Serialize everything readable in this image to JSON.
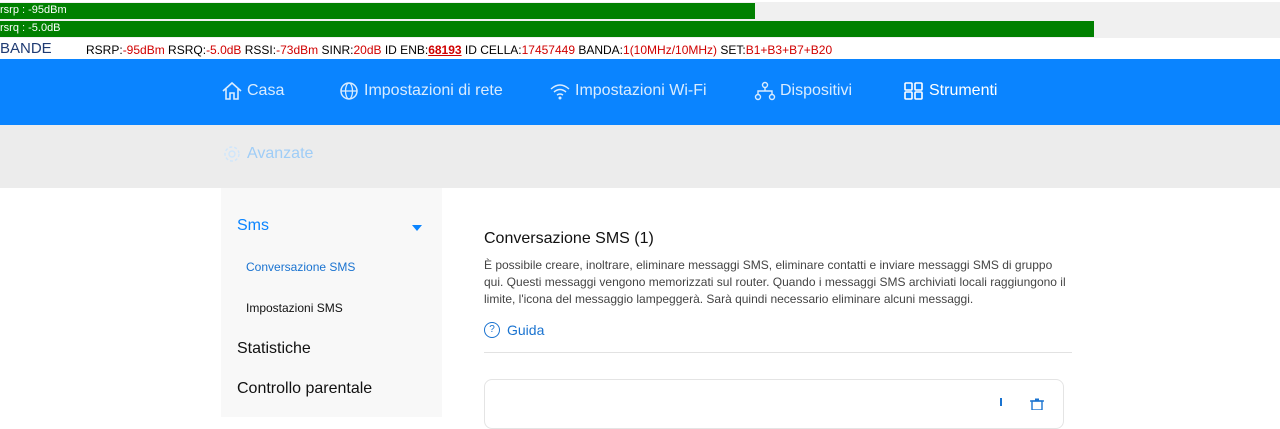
{
  "signal": {
    "rsrp_label": "rsrp : -95dBm",
    "rsrp_level": 0.59,
    "rsrq_label": "rsrq : -5.0dB",
    "rsrq_level": 0.855,
    "bar_color": "#008000"
  },
  "bande": {
    "title": "BANDE",
    "rsrp_key": "RSRP:",
    "rsrp_val": "-95dBm",
    "rsrq_key": " RSRQ:",
    "rsrq_val": "-5.0dB",
    "rssi_key": " RSSI:",
    "rssi_val": "-73dBm",
    "sinr_key": " SINR:",
    "sinr_val": "20dB",
    "enb_key": " ID ENB:",
    "enb_val": "68193",
    "cella_key": " ID CELLA:",
    "cella_val": "17457449",
    "banda_key": " BANDA:",
    "banda_val": "1(10MHz/10MHz)",
    "set_key": " SET:",
    "set_val": "B1+B3+B7+B20"
  },
  "nav": {
    "home": "Casa",
    "network": "Impostazioni di rete",
    "wifi": "Impostazioni Wi-Fi",
    "devices": "Dispositivi",
    "tools": "Strumenti"
  },
  "subnav": {
    "advanced": "Avanzate"
  },
  "sidebar": {
    "sms": "Sms",
    "sms_conversation": "Conversazione SMS",
    "sms_settings": "Impostazioni SMS",
    "statistics": "Statistiche",
    "parental": "Controllo parentale"
  },
  "content": {
    "title": "Conversazione SMS (1)",
    "description": "È possibile creare, inoltrare, eliminare messaggi SMS, eliminare contatti e inviare messaggi SMS di gruppo qui. Questi messaggi vengono memorizzati sul router. Quando i messaggi SMS archiviati locali raggiungono il limite, l'icona del messaggio lampeggerà. Sarà quindi necessario eliminare alcuni messaggi.",
    "guide": "Guida"
  },
  "colors": {
    "accent": "#0a84ff",
    "value_red": "#d00000"
  }
}
